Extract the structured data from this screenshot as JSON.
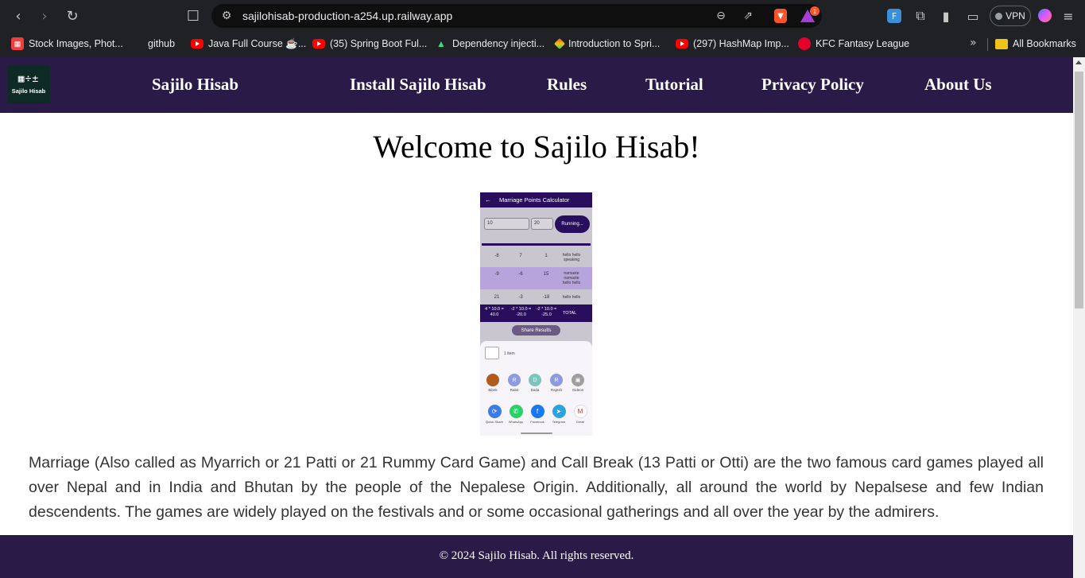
{
  "browser": {
    "url": "sajilohisab-production-a254.up.railway.app",
    "rewards_badge": "1",
    "vpn_label": "VPN",
    "bookmarks": [
      {
        "label": "Stock Images, Phot...",
        "icon": "stock-icon"
      },
      {
        "label": "github",
        "icon": "github-icon"
      },
      {
        "label": "Java Full Course ☕...",
        "icon": "youtube-icon"
      },
      {
        "label": "(35) Spring Boot Ful...",
        "icon": "youtube-icon"
      },
      {
        "label": "Dependency injecti...",
        "icon": "android-icon"
      },
      {
        "label": "Introduction to Spri...",
        "icon": "spring-icon"
      },
      {
        "label": "(297) HashMap Imp...",
        "icon": "youtube-icon"
      },
      {
        "label": "KFC Fantasy League",
        "icon": "kfc-icon"
      }
    ],
    "all_bookmarks_label": "All Bookmarks"
  },
  "site": {
    "logo_text": "Sajilo Hisab",
    "nav": {
      "brand": "Sajilo Hisab",
      "items": [
        "Install Sajilo Hisab",
        "Rules",
        "Tutorial",
        "Privacy Policy",
        "About Us"
      ]
    },
    "title": "Welcome to Sajilo Hisab!",
    "screenshot": {
      "app_title": "Marriage Points Calculator",
      "input_1": "10",
      "input_2": "20",
      "button": "Running...",
      "rows": [
        {
          "a": "-8",
          "b": "7",
          "c": "1",
          "note": "hello hello speaking"
        },
        {
          "a": "-9",
          "b": "-6",
          "c": "15",
          "note": "namaste namaste hello hello"
        },
        {
          "a": "21",
          "b": "-3",
          "c": "-18",
          "note": "hello hello"
        }
      ],
      "totals": [
        "4 * 10.0 = 40.0",
        "-2 * 10.0 = -20.0",
        "-2 * 10.0 = -25.0"
      ],
      "total_label": "TOTAL",
      "share_button": "Share Results",
      "share_item": "1 item",
      "contacts": [
        "Bibek",
        "Rabit",
        "Dada",
        "Rajesh",
        "Gideon"
      ],
      "apps": [
        "Quick Share",
        "WhatsApp",
        "Facebook",
        "Telegram",
        "Gmail"
      ]
    },
    "intro": "Marriage (Also called as Myarrich or 21 Patti or 21 Rummy Card Game) and Call Break (13 Patti or Otti) are the two famous card games played all over Nepal and in India and Bhutan by the people of the Nepalese Origin. Additionally, all around the world by Nepalsese and few Indian descendents. The games are widely played on the festivals and or some occasional gatherings and all over the year by the admirers.",
    "footer": "© 2024 Sajilo Hisab. All rights reserved."
  },
  "colors": {
    "nav_bg": "#2a1a47",
    "app_purple": "#2a0e5e",
    "chrome_bg": "#202124"
  }
}
